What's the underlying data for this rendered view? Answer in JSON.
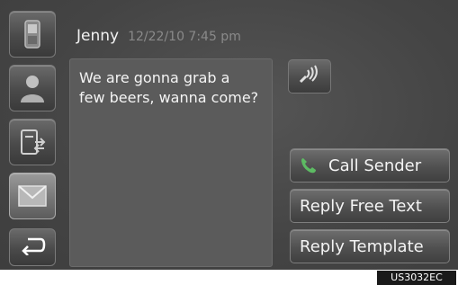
{
  "message": {
    "sender": "Jenny",
    "timestamp": "12/22/10 7:45 pm",
    "body": "We are gonna grab a few beers, wanna come?"
  },
  "sidebar": {
    "items": [
      {
        "icon": "phone-icon",
        "active": false
      },
      {
        "icon": "contact-icon",
        "active": false
      },
      {
        "icon": "call-history-icon",
        "active": false
      },
      {
        "icon": "message-icon",
        "active": true
      },
      {
        "icon": "back-icon",
        "active": false
      }
    ]
  },
  "actions": {
    "call_sender": "Call Sender",
    "reply_free_text": "Reply Free Text",
    "reply_template": "Reply Template"
  },
  "watermark": "US3032EC",
  "colors": {
    "screen_bg": "#4a4a4a",
    "panel_bg": "#5b5b5b",
    "phone_icon_green": "#5dbb63"
  }
}
